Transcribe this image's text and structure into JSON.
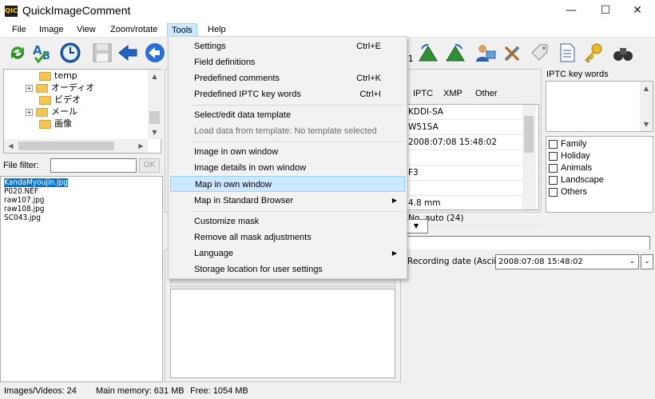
{
  "window": {
    "title": "QuickImageComment",
    "app_icon_text": "QIC"
  },
  "window_controls": {
    "minimize": "—",
    "maximize": "☐",
    "close": "✕"
  },
  "menubar": {
    "file": "File",
    "image": "Image",
    "view": "View",
    "zoom": "Zoom/rotate",
    "tools": "Tools",
    "help": "Help"
  },
  "toolbar": {
    "partial_label": ":1"
  },
  "folder_tree": {
    "items": [
      {
        "label": "temp",
        "expander": ""
      },
      {
        "label": "オーディオ",
        "expander": "+"
      },
      {
        "label": "ビデオ",
        "expander": ""
      },
      {
        "label": "メール",
        "expander": "+"
      },
      {
        "label": "画像",
        "expander": ""
      }
    ]
  },
  "file_filter": {
    "label": "File filter:",
    "value": "",
    "ok_label": "OK"
  },
  "file_list": [
    "KandaMyoujin.jpg",
    "P020.NEF",
    "raw107.jpg",
    "raw108.jpg",
    "SC043.jpg"
  ],
  "properties": {
    "tabs": [
      "IPTC",
      "XMP",
      "Other"
    ],
    "rows": [
      "KDDI-SA",
      "W51SA",
      "2008:07:08 15:48:02",
      "",
      "F3",
      "",
      "4.8 mm",
      "No, auto (24)"
    ]
  },
  "iptc_keywords": {
    "title": "IPTC key words",
    "checkboxes": [
      "Family",
      "Holiday",
      "Animals",
      "Landscape",
      "Others"
    ]
  },
  "recording_date": {
    "label": "Recording date (Ascii)",
    "value": "2008:07:08 15:48:02"
  },
  "tools_menu": {
    "items": {
      "settings": {
        "label": "Settings",
        "shortcut": "Ctrl+E"
      },
      "field_definitions": {
        "label": "Field definitions"
      },
      "predefined_comments": {
        "label": "Predefined comments",
        "shortcut": "Ctrl+K"
      },
      "predefined_iptc": {
        "label": "Predefined IPTC key words",
        "shortcut": "Ctrl+I"
      },
      "select_template": {
        "label": "Select/edit data template"
      },
      "load_template": {
        "label": "Load data from template: No template selected"
      },
      "image_own_window": {
        "label": "Image in own window"
      },
      "image_details": {
        "label": "Image details in own window"
      },
      "map_own_window": {
        "label": "Map in own window"
      },
      "map_browser": {
        "label": "Map in Standard Browser"
      },
      "customize_mask": {
        "label": "Customize mask"
      },
      "remove_mask": {
        "label": "Remove all mask adjustments"
      },
      "language": {
        "label": "Language"
      },
      "storage_location": {
        "label": "Storage location for user settings"
      }
    },
    "submenu_arrow": "▶"
  },
  "statusbar": {
    "images": "Images/Videos: 24",
    "memory": "Main memory: 631 MB",
    "free": "Free: 1054 MB"
  },
  "colors": {
    "accent": "#0078d7",
    "hover": "#cce8ff"
  }
}
